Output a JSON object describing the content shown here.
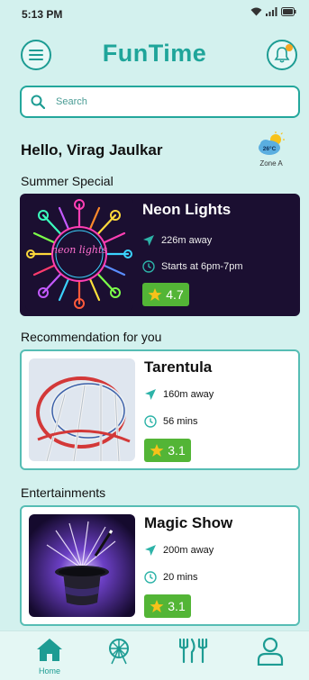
{
  "status_bar": {
    "time": "5:13 PM"
  },
  "header": {
    "title": "FunTime"
  },
  "search": {
    "placeholder": "Search"
  },
  "greeting": "Hello, Virag Jaulkar",
  "weather": {
    "temp": "26°C",
    "zone": "Zone A"
  },
  "sections": {
    "summer": "Summer Special",
    "recommendation": "Recommendation for you",
    "entertainments": "Entertainments"
  },
  "cards": [
    {
      "title": "Neon Lights",
      "logo_text": "neon lights",
      "distance": "226m away",
      "time": "Starts at 6pm-7pm",
      "rating": "4.7"
    },
    {
      "title": "Tarentula",
      "distance": "160m away",
      "time": "56 mins",
      "rating": "3.1"
    },
    {
      "title": "Magic Show",
      "distance": "200m away",
      "time": "20 mins",
      "rating": "3.1"
    }
  ],
  "nav": {
    "home_label": "Home"
  },
  "colors": {
    "accent": "#1fa59a",
    "rating_bg": "#53b536",
    "background": "#d3f1ee"
  }
}
